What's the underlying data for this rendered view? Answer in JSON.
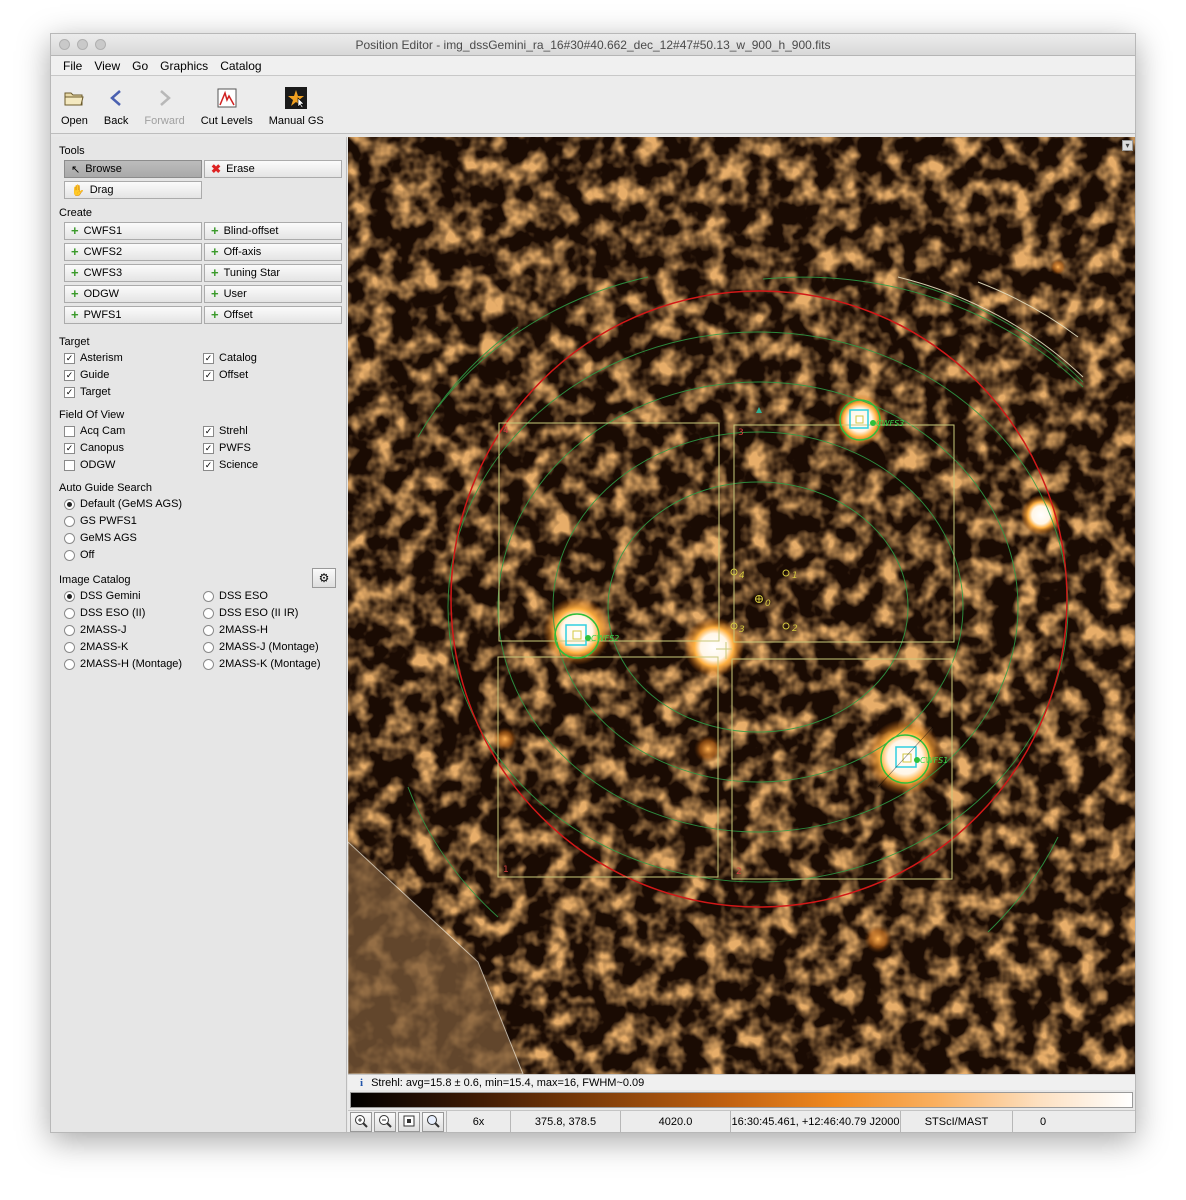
{
  "window": {
    "title": "Position Editor - img_dssGemini_ra_16#30#40.662_dec_12#47#50.13_w_900_h_900.fits"
  },
  "menu": [
    "File",
    "View",
    "Go",
    "Graphics",
    "Catalog"
  ],
  "toolbar": {
    "open": "Open",
    "back": "Back",
    "forward": "Forward",
    "cut_levels": "Cut Levels",
    "manual_gs": "Manual GS"
  },
  "tools": {
    "heading": "Tools",
    "browse": "Browse",
    "erase": "Erase",
    "drag": "Drag"
  },
  "create": {
    "heading": "Create",
    "items": [
      "CWFS1",
      "Blind-offset",
      "CWFS2",
      "Off-axis",
      "CWFS3",
      "Tuning Star",
      "ODGW",
      "User",
      "PWFS1",
      "Offset"
    ]
  },
  "target": {
    "heading": "Target",
    "items": [
      {
        "label": "Asterism",
        "checked": true
      },
      {
        "label": "Catalog",
        "checked": true
      },
      {
        "label": "Guide",
        "checked": true
      },
      {
        "label": "Offset",
        "checked": true
      },
      {
        "label": "Target",
        "checked": true
      }
    ]
  },
  "fov": {
    "heading": "Field Of View",
    "items": [
      {
        "label": "Acq Cam",
        "checked": false
      },
      {
        "label": "Strehl",
        "checked": true
      },
      {
        "label": "Canopus",
        "checked": true
      },
      {
        "label": "PWFS",
        "checked": true
      },
      {
        "label": "ODGW",
        "checked": false
      },
      {
        "label": "Science",
        "checked": true
      }
    ]
  },
  "ags": {
    "heading": "Auto Guide Search",
    "items": [
      {
        "label": "Default (GeMS AGS)",
        "selected": true
      },
      {
        "label": "GS PWFS1",
        "selected": false
      },
      {
        "label": "GeMS AGS",
        "selected": false
      },
      {
        "label": "Off",
        "selected": false
      }
    ]
  },
  "catalog": {
    "heading": "Image Catalog",
    "items": [
      {
        "label": "DSS Gemini",
        "selected": true
      },
      {
        "label": "DSS ESO",
        "selected": false
      },
      {
        "label": "DSS ESO (II)",
        "selected": false
      },
      {
        "label": "DSS ESO (II IR)",
        "selected": false
      },
      {
        "label": "2MASS-J",
        "selected": false
      },
      {
        "label": "2MASS-H",
        "selected": false
      },
      {
        "label": "2MASS-K",
        "selected": false
      },
      {
        "label": "2MASS-J (Montage)",
        "selected": false
      },
      {
        "label": "2MASS-H (Montage)",
        "selected": false
      },
      {
        "label": "2MASS-K (Montage)",
        "selected": false
      }
    ]
  },
  "overlay": {
    "quadrants": [
      "1",
      "2",
      "3",
      "4"
    ],
    "markers": [
      "0",
      "1",
      "2",
      "3",
      "4"
    ],
    "stars": [
      "CWFS1",
      "CWFS2",
      "CWFS3"
    ]
  },
  "status": {
    "info_icon": "i",
    "text": "Strehl: avg=15.8 ± 0.6,  min=15.4,  max=16,  FWHM~0.09"
  },
  "bottom": {
    "zoom": "6x",
    "xy": "375.8, 378.5",
    "value": "4020.0",
    "coords": "16:30:45.461, +12:46:40.79 J2000",
    "source": "STScI/MAST",
    "extra": "0"
  },
  "colors": {
    "red_circle": "#d01818",
    "green": "#2fbf3a",
    "probe": "#c8c87a",
    "cyan": "#30d0e0"
  }
}
